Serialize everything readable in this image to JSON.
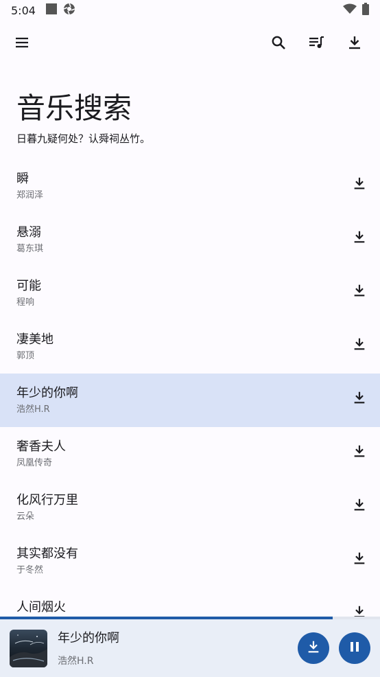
{
  "status_bar": {
    "time": "5:04"
  },
  "top_bar": {
    "icons": [
      "menu-icon",
      "search-icon",
      "queue-music-icon",
      "download-icon"
    ]
  },
  "header": {
    "title": "音乐搜索",
    "subtitle": "日暮九疑何处？认舜祠丛竹。"
  },
  "songs": [
    {
      "title": "瞬",
      "artist": "郑润泽",
      "active": false
    },
    {
      "title": "悬溺",
      "artist": "葛东琪",
      "active": false
    },
    {
      "title": "可能",
      "artist": "程响",
      "active": false
    },
    {
      "title": "凄美地",
      "artist": "郭顶",
      "active": false
    },
    {
      "title": "年少的你啊",
      "artist": "浩然H.R",
      "active": true
    },
    {
      "title": "奢香夫人",
      "artist": "凤凰传奇",
      "active": false
    },
    {
      "title": "化风行万里",
      "artist": "云朵",
      "active": false
    },
    {
      "title": "其实都没有",
      "artist": "于冬然",
      "active": false
    },
    {
      "title": "人间烟火",
      "artist": "",
      "active": false
    }
  ],
  "player": {
    "title": "年少的你啊",
    "artist": "浩然H.R",
    "progress": 0.875
  },
  "colors": {
    "background": "#FDFBFF",
    "active_row": "#D9E2F7",
    "accent": "#1F5BA8",
    "player_bg": "#E9EEF7"
  }
}
